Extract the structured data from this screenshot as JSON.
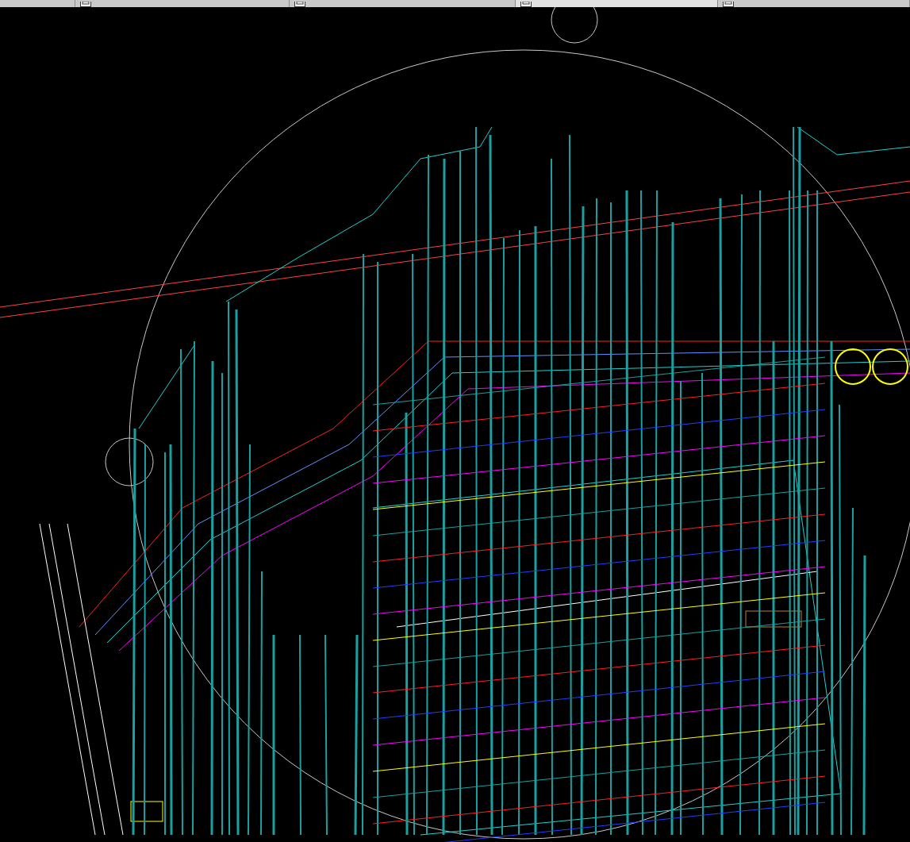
{
  "tabs": [
    {
      "selected": false,
      "has_icon": false
    },
    {
      "selected": false,
      "has_icon": true
    },
    {
      "selected": false,
      "has_icon": true
    },
    {
      "selected": true,
      "has_icon": true
    },
    {
      "selected": false,
      "has_icon": true
    }
  ]
}
